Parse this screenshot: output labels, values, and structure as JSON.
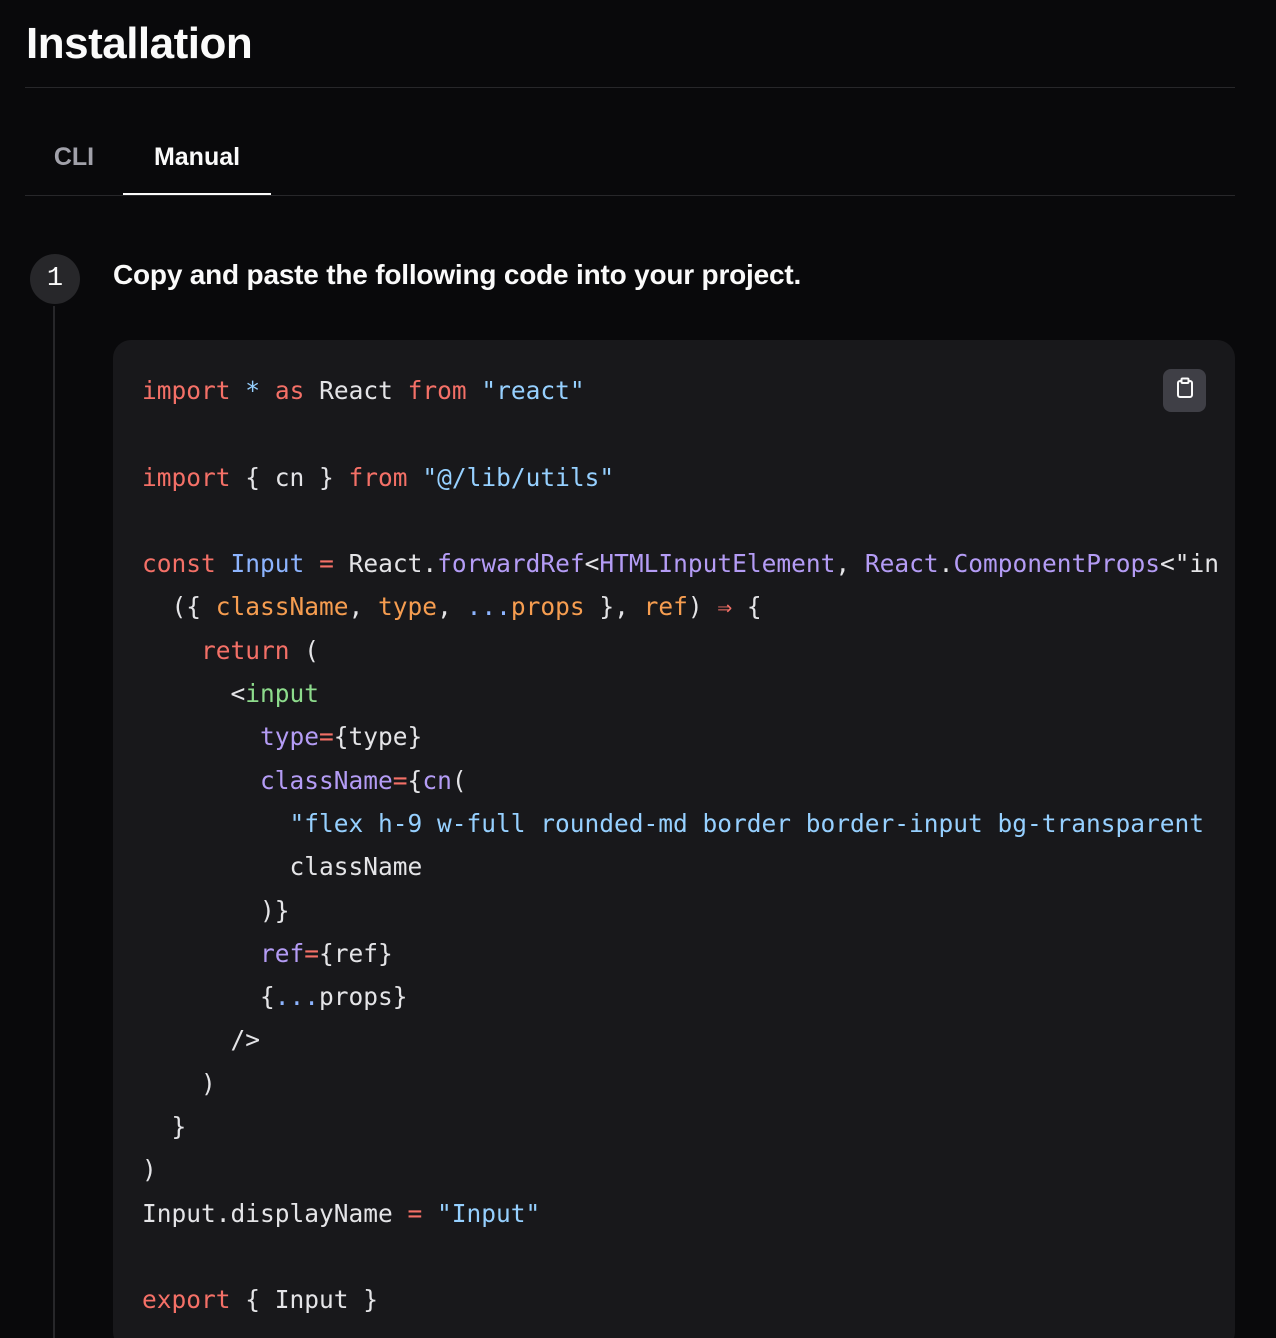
{
  "page": {
    "title": "Installation"
  },
  "tabs": [
    {
      "label": "CLI",
      "active": false
    },
    {
      "label": "Manual",
      "active": true
    }
  ],
  "step": {
    "number": "1",
    "heading": "Copy and paste the following code into your project."
  },
  "code_block": {
    "copy_icon": "clipboard-icon",
    "colors": {
      "keyword": "#f47067",
      "string": "#96d0ff",
      "name": "#8db4ff",
      "function": "#b49cf5",
      "param": "#f69d50",
      "tag": "#8ddb8c",
      "plain": "#e4e4e7"
    },
    "lines": [
      [
        [
          "import",
          "keyword"
        ],
        [
          " ",
          "plain"
        ],
        [
          "*",
          "string"
        ],
        [
          " ",
          "plain"
        ],
        [
          "as",
          "keyword"
        ],
        [
          " React ",
          "plain"
        ],
        [
          "from",
          "keyword"
        ],
        [
          " ",
          "plain"
        ],
        [
          "\"react\"",
          "string"
        ]
      ],
      [],
      [
        [
          "import",
          "keyword"
        ],
        [
          " { cn } ",
          "plain"
        ],
        [
          "from",
          "keyword"
        ],
        [
          " ",
          "plain"
        ],
        [
          "\"@/lib/utils\"",
          "string"
        ]
      ],
      [],
      [
        [
          "const",
          "keyword"
        ],
        [
          " ",
          "plain"
        ],
        [
          "Input",
          "name"
        ],
        [
          " ",
          "plain"
        ],
        [
          "=",
          "keyword"
        ],
        [
          " React.",
          "plain"
        ],
        [
          "forwardRef",
          "function"
        ],
        [
          "<",
          "plain"
        ],
        [
          "HTMLInputElement",
          "function"
        ],
        [
          ", ",
          "plain"
        ],
        [
          "React",
          "function"
        ],
        [
          ".",
          "plain"
        ],
        [
          "ComponentProps",
          "function"
        ],
        [
          "<\"in",
          "plain"
        ]
      ],
      [
        [
          "  ({ ",
          "plain"
        ],
        [
          "className",
          "param"
        ],
        [
          ", ",
          "plain"
        ],
        [
          "type",
          "param"
        ],
        [
          ", ",
          "plain"
        ],
        [
          "...",
          "name"
        ],
        [
          "props",
          "param"
        ],
        [
          " }, ",
          "plain"
        ],
        [
          "ref",
          "param"
        ],
        [
          ") ",
          "plain"
        ],
        [
          "⇒",
          "keyword"
        ],
        [
          " {",
          "plain"
        ]
      ],
      [
        [
          "    ",
          "plain"
        ],
        [
          "return",
          "keyword"
        ],
        [
          " (",
          "plain"
        ]
      ],
      [
        [
          "      <",
          "plain"
        ],
        [
          "input",
          "tag"
        ]
      ],
      [
        [
          "        ",
          "plain"
        ],
        [
          "type",
          "function"
        ],
        [
          "=",
          "keyword"
        ],
        [
          "{type}",
          "plain"
        ]
      ],
      [
        [
          "        ",
          "plain"
        ],
        [
          "className",
          "function"
        ],
        [
          "=",
          "keyword"
        ],
        [
          "{",
          "plain"
        ],
        [
          "cn",
          "function"
        ],
        [
          "(",
          "plain"
        ]
      ],
      [
        [
          "          ",
          "plain"
        ],
        [
          "\"flex h-9 w-full rounded-md border border-input bg-transparent",
          "string"
        ]
      ],
      [
        [
          "          className",
          "plain"
        ]
      ],
      [
        [
          "        )}",
          "plain"
        ]
      ],
      [
        [
          "        ",
          "plain"
        ],
        [
          "ref",
          "function"
        ],
        [
          "=",
          "keyword"
        ],
        [
          "{ref}",
          "plain"
        ]
      ],
      [
        [
          "        {",
          "plain"
        ],
        [
          "...",
          "name"
        ],
        [
          "props}",
          "plain"
        ]
      ],
      [
        [
          "      />",
          "plain"
        ]
      ],
      [
        [
          "    )",
          "plain"
        ]
      ],
      [
        [
          "  }",
          "plain"
        ]
      ],
      [
        [
          ")",
          "plain"
        ]
      ],
      [
        [
          "Input.displayName ",
          "plain"
        ],
        [
          "=",
          "keyword"
        ],
        [
          " ",
          "plain"
        ],
        [
          "\"Input\"",
          "string"
        ]
      ],
      [],
      [
        [
          "export",
          "keyword"
        ],
        [
          " { Input }",
          "plain"
        ]
      ]
    ]
  }
}
